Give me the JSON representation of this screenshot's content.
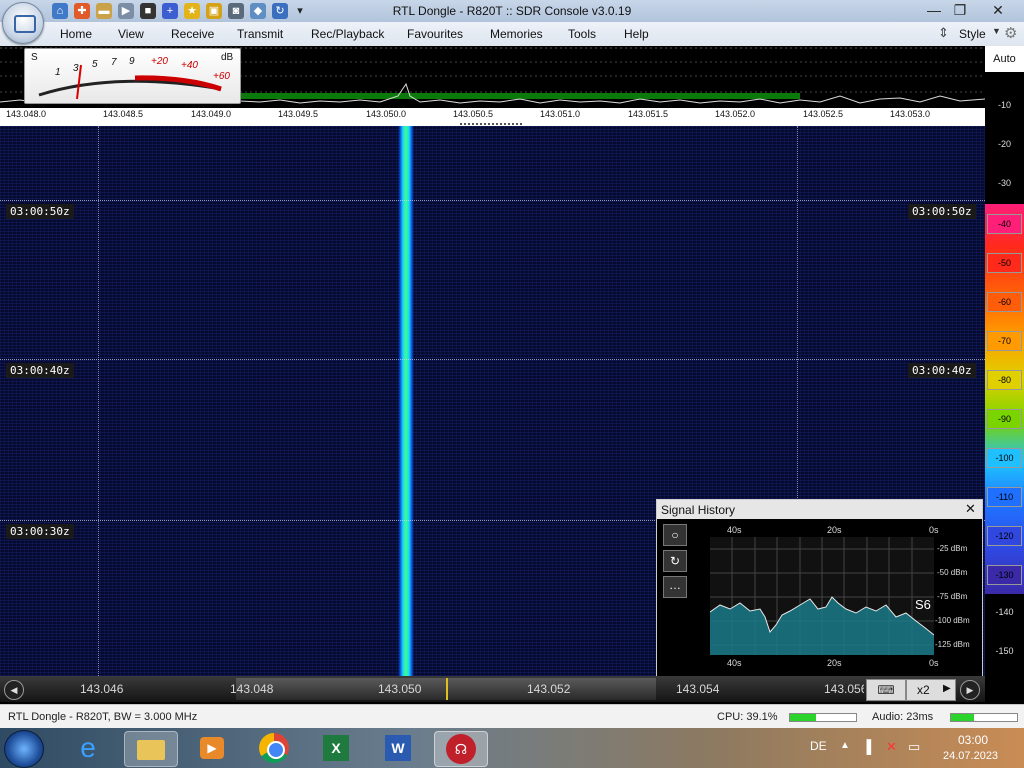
{
  "window": {
    "title": "RTL Dongle - R820T :: SDR Console v3.0.19",
    "style_label": "Style"
  },
  "menu": {
    "items": [
      "Home",
      "View",
      "Receive",
      "Transmit",
      "Rec/Playback",
      "Favourites",
      "Memories",
      "Tools",
      "Help"
    ]
  },
  "smeter": {
    "s_label": "S",
    "db_label": "dB",
    "scale": [
      "1",
      "3",
      "5",
      "7",
      "9",
      "+20",
      "+40",
      "+60"
    ]
  },
  "spectrum": {
    "freq_ticks": [
      "143.048.0",
      "143.048.5",
      "143.049.0",
      "143.049.5",
      "143.050.0",
      "143.050.5",
      "143.051.0",
      "143.051.5",
      "143.052.0",
      "143.052.5",
      "143.053.0"
    ]
  },
  "dbscale": {
    "auto_label": "Auto",
    "plain_top": [
      "-10",
      "-20",
      "-30"
    ],
    "colored": [
      "-40",
      "-50",
      "-60",
      "-70",
      "-80",
      "-90",
      "-100",
      "-110",
      "-120",
      "-130"
    ],
    "plain_bottom": [
      "-140",
      "-150"
    ],
    "colors": [
      "#ff1e78",
      "#ff2a1a",
      "#ff5d0a",
      "#ff9a00",
      "#e0d000",
      "#7ad400",
      "#1ec0ff",
      "#2070ff",
      "#3048e0",
      "#3a2aa8"
    ]
  },
  "waterfall": {
    "time_labels": [
      "03:00:50z",
      "03:00:40z",
      "03:00:30z"
    ]
  },
  "tuning": {
    "freqs": [
      "143.046",
      "143.048",
      "143.050",
      "143.052",
      "143.054",
      "143.056"
    ],
    "zoom_label": "x2"
  },
  "signal_history": {
    "title": "Signal History",
    "top_time_labels": [
      "40s",
      "20s",
      "0s"
    ],
    "bottom_time_labels": [
      "40s",
      "20s",
      "0s"
    ],
    "dbm_labels": [
      "-25 dBm",
      "-50 dBm",
      "-75 dBm",
      "-100 dBm",
      "-125 dBm"
    ],
    "s_reading": "S6"
  },
  "status": {
    "device": "RTL Dongle - R820T, BW = 3.000 MHz",
    "cpu": "CPU: 39.1%",
    "cpu_fraction": 0.39,
    "audio": "Audio: 23ms",
    "audio_fraction": 0.35
  },
  "taskbar": {
    "lang": "DE",
    "time": "03:00",
    "date": "24.07.2023",
    "apps": [
      "internet-explorer",
      "file-explorer",
      "media-player",
      "chrome",
      "excel",
      "word",
      "sdr-console"
    ]
  }
}
